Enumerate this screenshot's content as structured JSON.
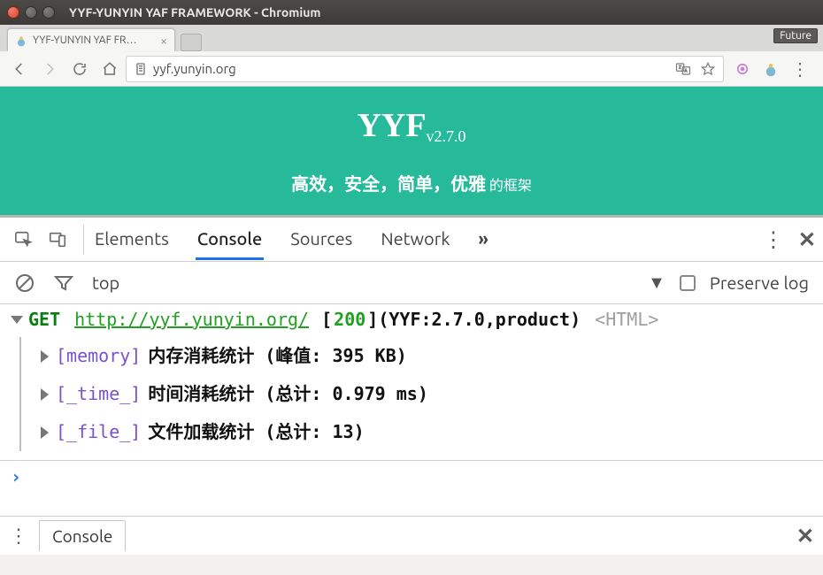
{
  "window": {
    "title": "YYF-YUNYIN YAF FRAMEWORK - Chromium"
  },
  "tab": {
    "title": "YYF-YUNYIN YAF FR…",
    "future_badge": "Future"
  },
  "toolbar": {
    "url": "yyf.yunyin.org"
  },
  "page": {
    "heading": "YYF",
    "version": "v2.7.0",
    "tagline_strong": "高效，安全，简单，优雅",
    "tagline_small": " 的框架"
  },
  "devtools": {
    "tabs": {
      "elements": "Elements",
      "console": "Console",
      "sources": "Sources",
      "network": "Network"
    },
    "more_symbol": "»",
    "context": "top",
    "preserve_log": "Preserve log"
  },
  "log": {
    "method": "GET",
    "url": "http://yyf.yunyin.org/",
    "open_bracket": " [",
    "status": "200",
    "close_bracket_meta": "](YYF:2.7.0,product)",
    "html_tag": "<HTML>",
    "children": [
      {
        "label": "[memory]",
        "text": " 内存消耗统计 (峰值: 395 KB)"
      },
      {
        "label": "[_time_]",
        "text": " 时间消耗统计 (总计: 0.979 ms)"
      },
      {
        "label": "[_file_]",
        "text": " 文件加载统计 (总计: 13)"
      }
    ]
  },
  "prompt": "›",
  "drawer": {
    "tab": "Console"
  }
}
